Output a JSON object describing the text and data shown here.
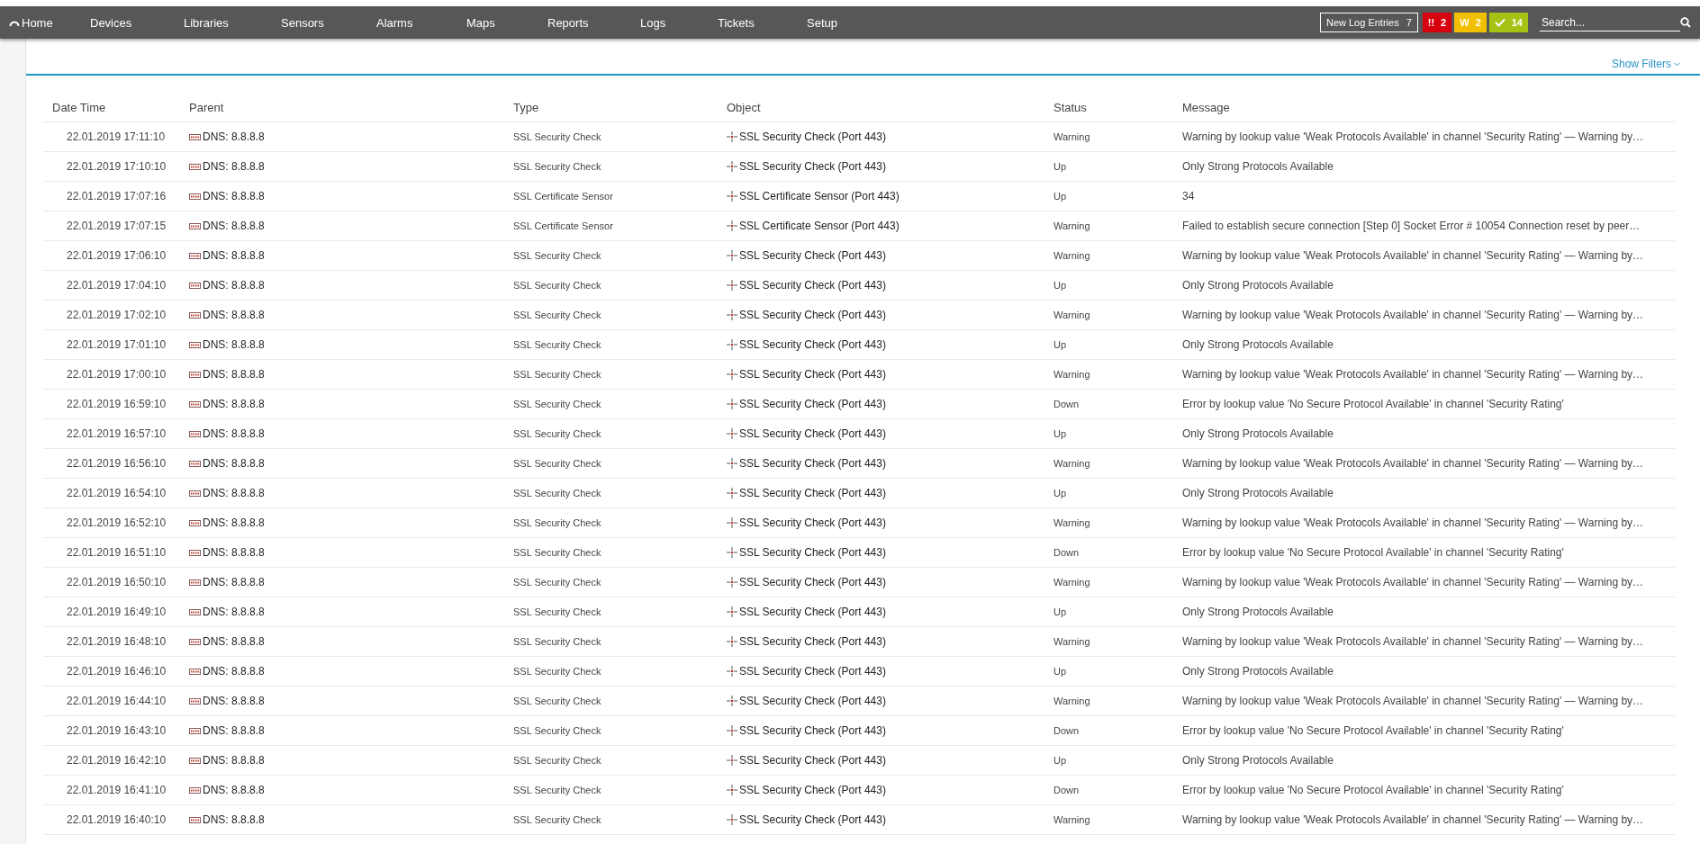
{
  "nav": {
    "items": [
      "Home",
      "Devices",
      "Libraries",
      "Sensors",
      "Alarms",
      "Maps",
      "Reports",
      "Logs",
      "Tickets",
      "Setup"
    ],
    "new_log_entries": {
      "label": "New Log Entries",
      "count": "7"
    },
    "alert_badges": [
      {
        "kind": "down",
        "symbol": "!!",
        "count": "2",
        "color": "#d7000f"
      },
      {
        "kind": "warning",
        "symbol": "W",
        "count": "2",
        "color": "#f0c000"
      },
      {
        "kind": "up",
        "count": "14",
        "color": "#a6c214"
      }
    ],
    "search": {
      "placeholder": "Search..."
    }
  },
  "filters": {
    "toggle": "Show Filters"
  },
  "table": {
    "columns": [
      "Date Time",
      "Parent",
      "Type",
      "Object",
      "Status",
      "Message"
    ],
    "rows": [
      {
        "date_time": "22.01.2019 17:11:10",
        "parent": "DNS: 8.8.8.8",
        "type": "SSL Security Check",
        "object": "SSL Security Check (Port 443)",
        "status": "Warning",
        "message": "Warning by lookup value 'Weak Protocols Available' in channel 'Security Rating' — Warning by…"
      },
      {
        "date_time": "22.01.2019 17:10:10",
        "parent": "DNS: 8.8.8.8",
        "type": "SSL Security Check",
        "object": "SSL Security Check (Port 443)",
        "status": "Up",
        "message": "Only Strong Protocols Available"
      },
      {
        "date_time": "22.01.2019 17:07:16",
        "parent": "DNS: 8.8.8.8",
        "type": "SSL Certificate Sensor",
        "object": "SSL Certificate Sensor (Port 443)",
        "status": "Up",
        "message": "34"
      },
      {
        "date_time": "22.01.2019 17:07:15",
        "parent": "DNS: 8.8.8.8",
        "type": "SSL Certificate Sensor",
        "object": "SSL Certificate Sensor (Port 443)",
        "status": "Warning",
        "message": "Failed to establish secure connection [Step 0] Socket Error # 10054 Connection reset by peer…"
      },
      {
        "date_time": "22.01.2019 17:06:10",
        "parent": "DNS: 8.8.8.8",
        "type": "SSL Security Check",
        "object": "SSL Security Check (Port 443)",
        "status": "Warning",
        "message": "Warning by lookup value 'Weak Protocols Available' in channel 'Security Rating' — Warning by…"
      },
      {
        "date_time": "22.01.2019 17:04:10",
        "parent": "DNS: 8.8.8.8",
        "type": "SSL Security Check",
        "object": "SSL Security Check (Port 443)",
        "status": "Up",
        "message": "Only Strong Protocols Available"
      },
      {
        "date_time": "22.01.2019 17:02:10",
        "parent": "DNS: 8.8.8.8",
        "type": "SSL Security Check",
        "object": "SSL Security Check (Port 443)",
        "status": "Warning",
        "message": "Warning by lookup value 'Weak Protocols Available' in channel 'Security Rating' — Warning by…"
      },
      {
        "date_time": "22.01.2019 17:01:10",
        "parent": "DNS: 8.8.8.8",
        "type": "SSL Security Check",
        "object": "SSL Security Check (Port 443)",
        "status": "Up",
        "message": "Only Strong Protocols Available"
      },
      {
        "date_time": "22.01.2019 17:00:10",
        "parent": "DNS: 8.8.8.8",
        "type": "SSL Security Check",
        "object": "SSL Security Check (Port 443)",
        "status": "Warning",
        "message": "Warning by lookup value 'Weak Protocols Available' in channel 'Security Rating' — Warning by…"
      },
      {
        "date_time": "22.01.2019 16:59:10",
        "parent": "DNS: 8.8.8.8",
        "type": "SSL Security Check",
        "object": "SSL Security Check (Port 443)",
        "status": "Down",
        "message": "Error by lookup value 'No Secure Protocol Available' in channel 'Security Rating'"
      },
      {
        "date_time": "22.01.2019 16:57:10",
        "parent": "DNS: 8.8.8.8",
        "type": "SSL Security Check",
        "object": "SSL Security Check (Port 443)",
        "status": "Up",
        "message": "Only Strong Protocols Available"
      },
      {
        "date_time": "22.01.2019 16:56:10",
        "parent": "DNS: 8.8.8.8",
        "type": "SSL Security Check",
        "object": "SSL Security Check (Port 443)",
        "status": "Warning",
        "message": "Warning by lookup value 'Weak Protocols Available' in channel 'Security Rating' — Warning by…"
      },
      {
        "date_time": "22.01.2019 16:54:10",
        "parent": "DNS: 8.8.8.8",
        "type": "SSL Security Check",
        "object": "SSL Security Check (Port 443)",
        "status": "Up",
        "message": "Only Strong Protocols Available"
      },
      {
        "date_time": "22.01.2019 16:52:10",
        "parent": "DNS: 8.8.8.8",
        "type": "SSL Security Check",
        "object": "SSL Security Check (Port 443)",
        "status": "Warning",
        "message": "Warning by lookup value 'Weak Protocols Available' in channel 'Security Rating' — Warning by…"
      },
      {
        "date_time": "22.01.2019 16:51:10",
        "parent": "DNS: 8.8.8.8",
        "type": "SSL Security Check",
        "object": "SSL Security Check (Port 443)",
        "status": "Down",
        "message": "Error by lookup value 'No Secure Protocol Available' in channel 'Security Rating'"
      },
      {
        "date_time": "22.01.2019 16:50:10",
        "parent": "DNS: 8.8.8.8",
        "type": "SSL Security Check",
        "object": "SSL Security Check (Port 443)",
        "status": "Warning",
        "message": "Warning by lookup value 'Weak Protocols Available' in channel 'Security Rating' — Warning by…"
      },
      {
        "date_time": "22.01.2019 16:49:10",
        "parent": "DNS: 8.8.8.8",
        "type": "SSL Security Check",
        "object": "SSL Security Check (Port 443)",
        "status": "Up",
        "message": "Only Strong Protocols Available"
      },
      {
        "date_time": "22.01.2019 16:48:10",
        "parent": "DNS: 8.8.8.8",
        "type": "SSL Security Check",
        "object": "SSL Security Check (Port 443)",
        "status": "Warning",
        "message": "Warning by lookup value 'Weak Protocols Available' in channel 'Security Rating' — Warning by…"
      },
      {
        "date_time": "22.01.2019 16:46:10",
        "parent": "DNS: 8.8.8.8",
        "type": "SSL Security Check",
        "object": "SSL Security Check (Port 443)",
        "status": "Up",
        "message": "Only Strong Protocols Available"
      },
      {
        "date_time": "22.01.2019 16:44:10",
        "parent": "DNS: 8.8.8.8",
        "type": "SSL Security Check",
        "object": "SSL Security Check (Port 443)",
        "status": "Warning",
        "message": "Warning by lookup value 'Weak Protocols Available' in channel 'Security Rating' — Warning by…"
      },
      {
        "date_time": "22.01.2019 16:43:10",
        "parent": "DNS: 8.8.8.8",
        "type": "SSL Security Check",
        "object": "SSL Security Check (Port 443)",
        "status": "Down",
        "message": "Error by lookup value 'No Secure Protocol Available' in channel 'Security Rating'"
      },
      {
        "date_time": "22.01.2019 16:42:10",
        "parent": "DNS: 8.8.8.8",
        "type": "SSL Security Check",
        "object": "SSL Security Check (Port 443)",
        "status": "Up",
        "message": "Only Strong Protocols Available"
      },
      {
        "date_time": "22.01.2019 16:41:10",
        "parent": "DNS: 8.8.8.8",
        "type": "SSL Security Check",
        "object": "SSL Security Check (Port 443)",
        "status": "Down",
        "message": "Error by lookup value 'No Secure Protocol Available' in channel 'Security Rating'"
      },
      {
        "date_time": "22.01.2019 16:40:10",
        "parent": "DNS: 8.8.8.8",
        "type": "SSL Security Check",
        "object": "SSL Security Check (Port 443)",
        "status": "Warning",
        "message": "Warning by lookup value 'Weak Protocols Available' in channel 'Security Rating' — Warning by…"
      }
    ]
  }
}
